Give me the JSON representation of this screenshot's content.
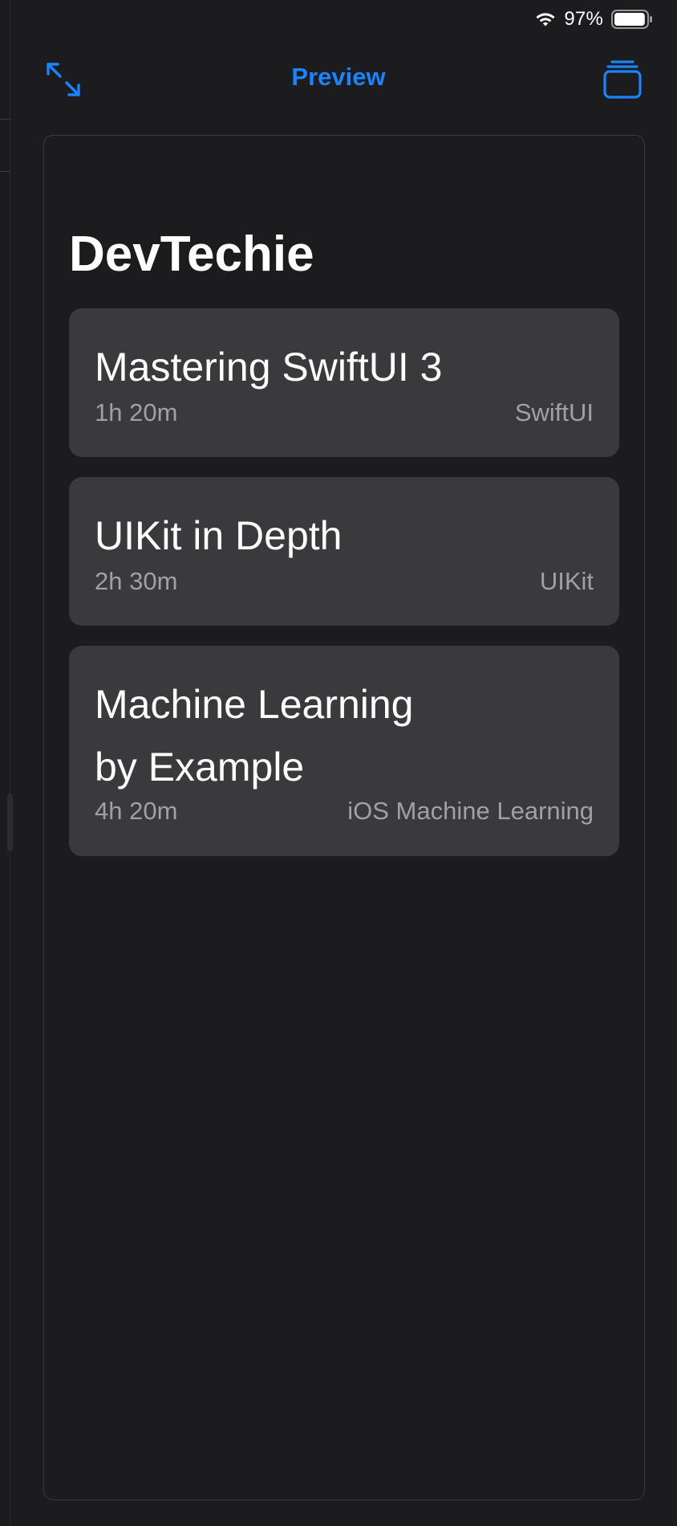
{
  "status_bar": {
    "battery_percent": "97%",
    "battery_level": 0.97,
    "wifi_icon": "wifi-icon",
    "battery_icon": "battery-icon"
  },
  "nav": {
    "title": "Preview",
    "left_icon": "expand-arrows-icon",
    "right_icon": "stack-windows-icon",
    "accent_color": "#1a84ff"
  },
  "preview": {
    "title": "DevTechie",
    "courses": [
      {
        "title": "Mastering SwiftUI 3",
        "duration": "1h 20m",
        "category": "SwiftUI"
      },
      {
        "title": "UIKit in Depth",
        "duration": "2h 30m",
        "category": "UIKit"
      },
      {
        "title": "Machine Learning\nby Example",
        "duration": "4h 20m",
        "category": "iOS Machine Learning"
      }
    ]
  },
  "colors": {
    "background": "#1c1c1e",
    "card": "#3a3a3c",
    "secondary_text": "#a0a0a5"
  }
}
